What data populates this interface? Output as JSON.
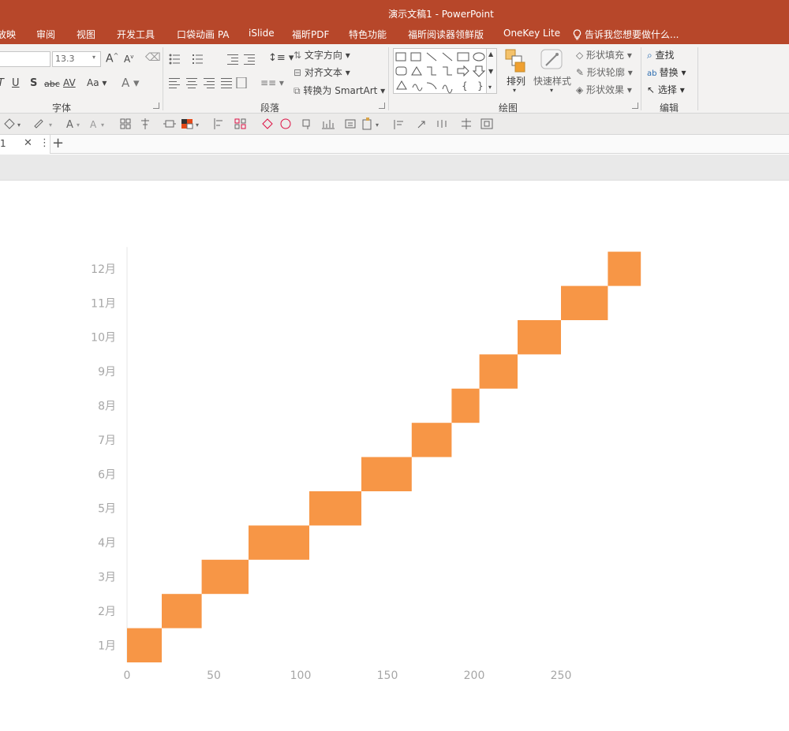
{
  "window": {
    "title": "演示文稿1 - PowerPoint"
  },
  "menu_tabs": [
    "放映",
    "审阅",
    "视图",
    "开发工具",
    "口袋动画 PA",
    "iSlide",
    "福昕PDF",
    "特色功能",
    "福昕阅读器领鲜版",
    "OneKey Lite"
  ],
  "tell_me": "告诉我您想要做什么...",
  "ribbon": {
    "font": {
      "name_value": "",
      "size_value": "13.3",
      "group_label": "字体"
    },
    "paragraph": {
      "text_direction": "文字方向",
      "align_text": "对齐文本",
      "convert_smartart": "转换为 SmartArt",
      "group_label": "段落"
    },
    "drawing": {
      "arrange": "排列",
      "quick_styles": "快速样式",
      "shape_fill": "形状填充",
      "shape_outline": "形状轮廓",
      "shape_effects": "形状效果",
      "group_label": "绘图"
    },
    "editing": {
      "find": "查找",
      "replace": "替换",
      "select": "选择",
      "group_label": "编辑"
    }
  },
  "doc_tab": {
    "label": "1"
  },
  "colors": {
    "accent": "#b7472a",
    "bar": "#f79646"
  },
  "chart_data": {
    "type": "bar",
    "orientation": "horizontal",
    "stacked": true,
    "categories": [
      "1月",
      "2月",
      "3月",
      "4月",
      "5月",
      "6月",
      "7月",
      "8月",
      "9月",
      "10月",
      "11月",
      "12月"
    ],
    "offsets": [
      0,
      20,
      43,
      70,
      105,
      135,
      164,
      187,
      203,
      225,
      250,
      277
    ],
    "values": [
      20,
      23,
      27,
      35,
      30,
      29,
      23,
      16,
      22,
      25,
      27,
      19
    ],
    "xticks": [
      0,
      50,
      100,
      150,
      200,
      250
    ],
    "xlim": [
      0,
      300
    ],
    "grid": false,
    "title": "",
    "xlabel": "",
    "ylabel": ""
  }
}
